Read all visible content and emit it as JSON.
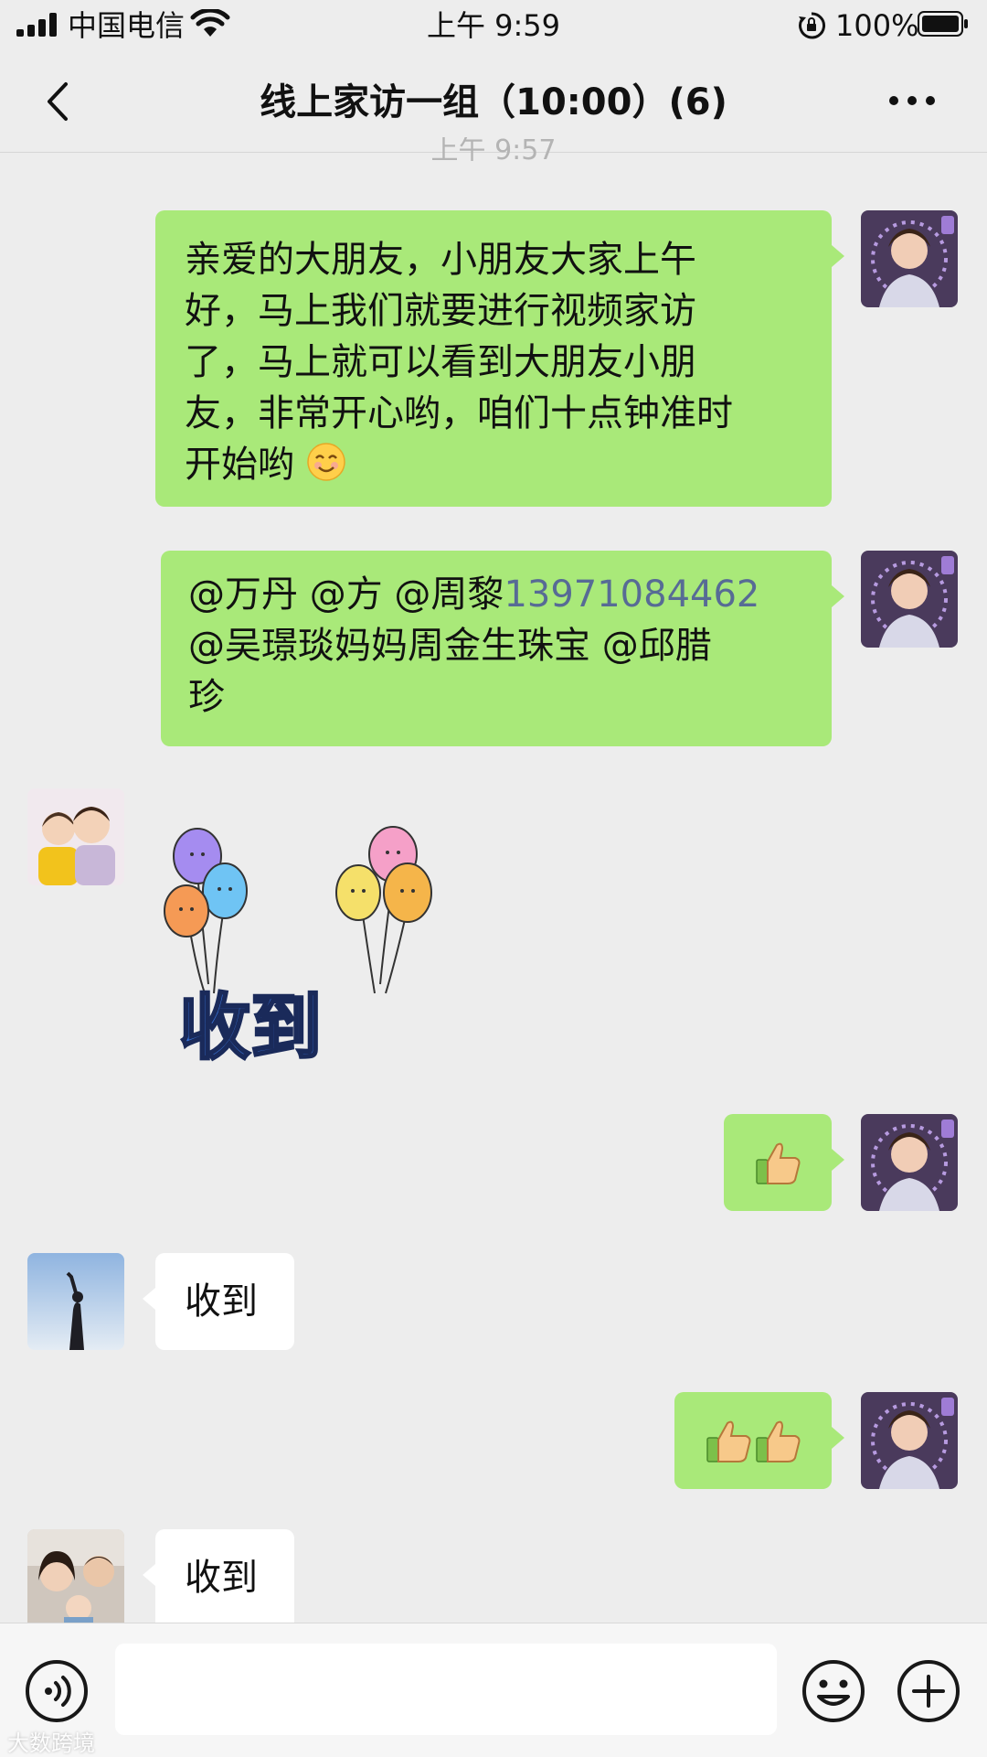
{
  "status_bar": {
    "carrier": "中国电信",
    "time": "上午 9:59",
    "battery_pct": "100%"
  },
  "header": {
    "title": "线上家访一组（10:00）(6)"
  },
  "time_divider_fragment": "上午 9:57",
  "messages": [
    {
      "side": "right",
      "lines": [
        "亲爱的大朋友，小朋友大家上午",
        "好，马上我们就要进行视频家访",
        "了，马上就可以看到大朋友小朋",
        "友，非常开心哟，咱们十点钟准时",
        "开始哟"
      ],
      "emoji": "smile-emoji"
    },
    {
      "side": "right",
      "line1_text": "@万丹 @方 @周黎",
      "line1_phone": "13971084462",
      "line2": "@吴璟琰妈妈周金生珠宝 @邱腊",
      "line3": "珍"
    },
    {
      "side": "left",
      "sticker": {
        "text": "收到",
        "icon": "balloons-sticker"
      }
    },
    {
      "side": "right",
      "emoji": "thumbs-up-emoji",
      "count": 1
    },
    {
      "side": "left",
      "text": "收到"
    },
    {
      "side": "right",
      "emoji": "thumbs-up-emoji",
      "count": 2
    },
    {
      "side": "left",
      "text": "收到"
    }
  ],
  "input_bar": {
    "placeholder": ""
  },
  "watermark": "大数跨境",
  "colors": {
    "bubble_mine": "#a9e979",
    "bubble_theirs": "#ffffff",
    "background": "#ededed",
    "phone_link": "#576b95"
  }
}
